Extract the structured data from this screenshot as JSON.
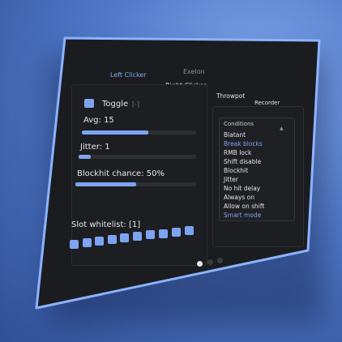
{
  "window": {
    "title": "Exelon"
  },
  "tabs": [
    {
      "label": "Left Clicker",
      "active": true
    },
    {
      "label": "Right Clicker",
      "active": false
    },
    {
      "label": "Throwpot",
      "active": false
    },
    {
      "label": "Recorder",
      "active": false
    }
  ],
  "left_panel": {
    "toggle": {
      "label": "Toggle",
      "bind_key": "[-]",
      "enabled": true
    },
    "sliders": [
      {
        "label": "Avg: 15",
        "fill_fraction": 0.58
      },
      {
        "label": "Jitter: 1",
        "fill_fraction": 0.1
      },
      {
        "label": "Blockhit chance: 50%",
        "fill_fraction": 0.5
      }
    ],
    "slot_whitelist": {
      "label": "Slot whitelist: [1]",
      "slots": 9
    }
  },
  "conditions": {
    "title": "Conditions",
    "items": [
      {
        "label": "Blatant",
        "selected": false
      },
      {
        "label": "Break blocks",
        "selected": true
      },
      {
        "label": "RMB lock",
        "selected": false
      },
      {
        "label": "Shift disable",
        "selected": false
      },
      {
        "label": "Blockhit",
        "selected": false
      },
      {
        "label": "Jitter",
        "selected": false
      },
      {
        "label": "No hit delay",
        "selected": false
      },
      {
        "label": "Always on",
        "selected": false
      },
      {
        "label": "Allow on shift",
        "selected": false
      },
      {
        "label": "Smart mode",
        "selected": true
      }
    ]
  },
  "pagination": {
    "pages": 3,
    "current": 1
  },
  "colors": {
    "accent": "#7da4f2",
    "window_bg": "#1b1c20",
    "border": "#8cb3ff"
  }
}
